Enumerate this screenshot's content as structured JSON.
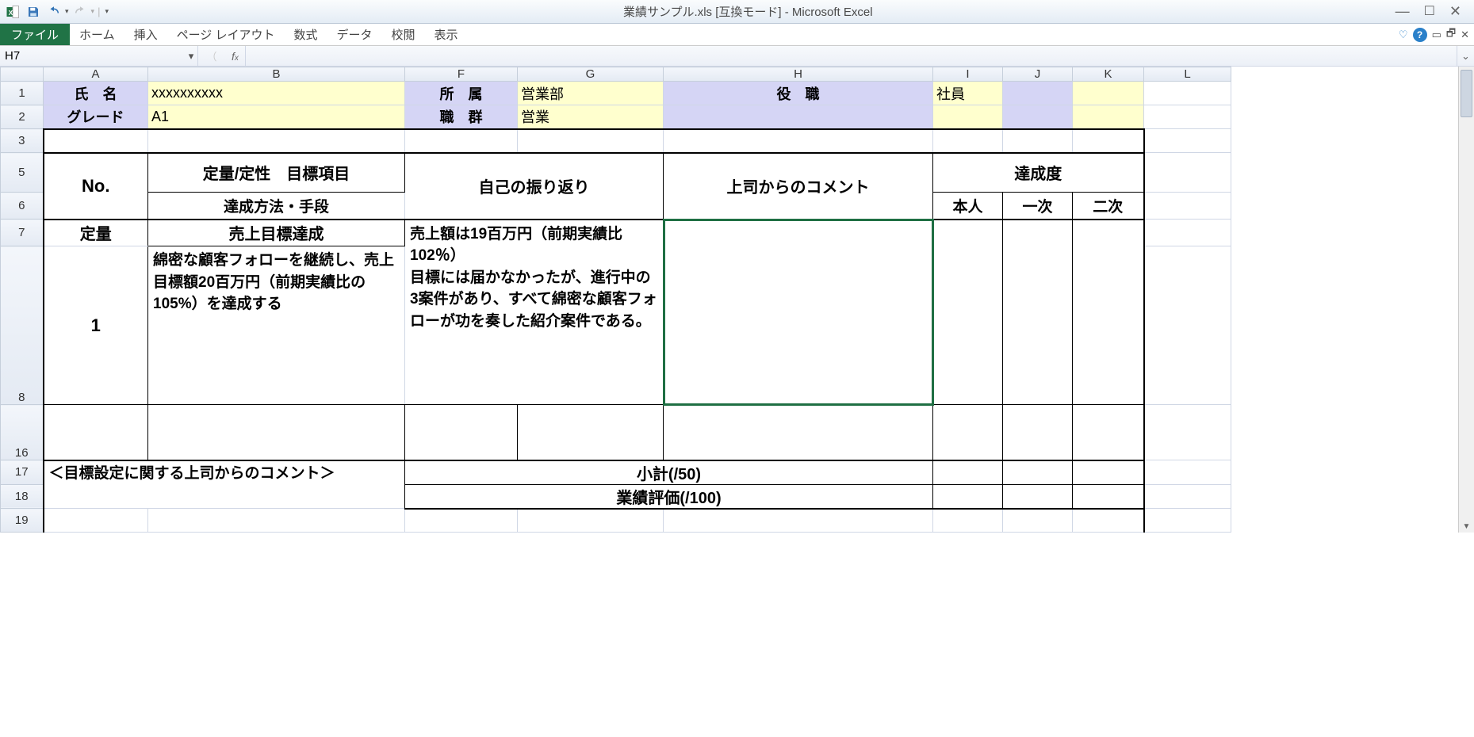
{
  "window": {
    "title": "業績サンプル.xls  [互換モード] - Microsoft Excel"
  },
  "ribbon": {
    "file": "ファイル",
    "tabs": [
      "ホーム",
      "挿入",
      "ページ レイアウト",
      "数式",
      "データ",
      "校閲",
      "表示"
    ]
  },
  "namebox": {
    "value": "H7",
    "fx": ""
  },
  "columns": [
    "A",
    "B",
    "F",
    "G",
    "H",
    "I",
    "J",
    "K",
    "L"
  ],
  "rows_visible": [
    "1",
    "2",
    "3",
    "5",
    "6",
    "7",
    "8",
    "16",
    "17",
    "18",
    "19"
  ],
  "header_info": {
    "r1": {
      "A": "氏　名",
      "B": "xxxxxxxxxx",
      "F": "所　属",
      "G": "営業部",
      "H": "役　職",
      "I": "社員",
      "J": "",
      "K": ""
    },
    "r2": {
      "A": "グレード",
      "B": "A1",
      "F": "職　群",
      "G": "営業",
      "H": "",
      "I": "",
      "J": "",
      "K": ""
    }
  },
  "table": {
    "h5": {
      "no": "No.",
      "goal": "定量/定性　目標項目",
      "self": "自己の振り返り",
      "boss": "上司からのコメント",
      "ach": "達成度"
    },
    "h6": {
      "method": "達成方法・手段",
      "p1": "本人",
      "p2": "一次",
      "p3": "二次"
    },
    "r7": {
      "A": "定量",
      "B": "売上目標達成"
    },
    "r8": {
      "A": "1",
      "B": "綿密な顧客フォローを継続し、売上目標額20百万円（前期実績比の105%）を達成する",
      "FG": "売上額は19百万円（前期実績比　102％）\n目標には届かなかったが、進行中の3案件があり、すべて綿密な顧客フォローが功を奏した紹介案件である。"
    },
    "r17": {
      "A": "＜目標設定に関する上司からのコメント＞",
      "FG": "小計(/50)"
    },
    "r18": {
      "FG": "業績評価(/100)"
    }
  }
}
